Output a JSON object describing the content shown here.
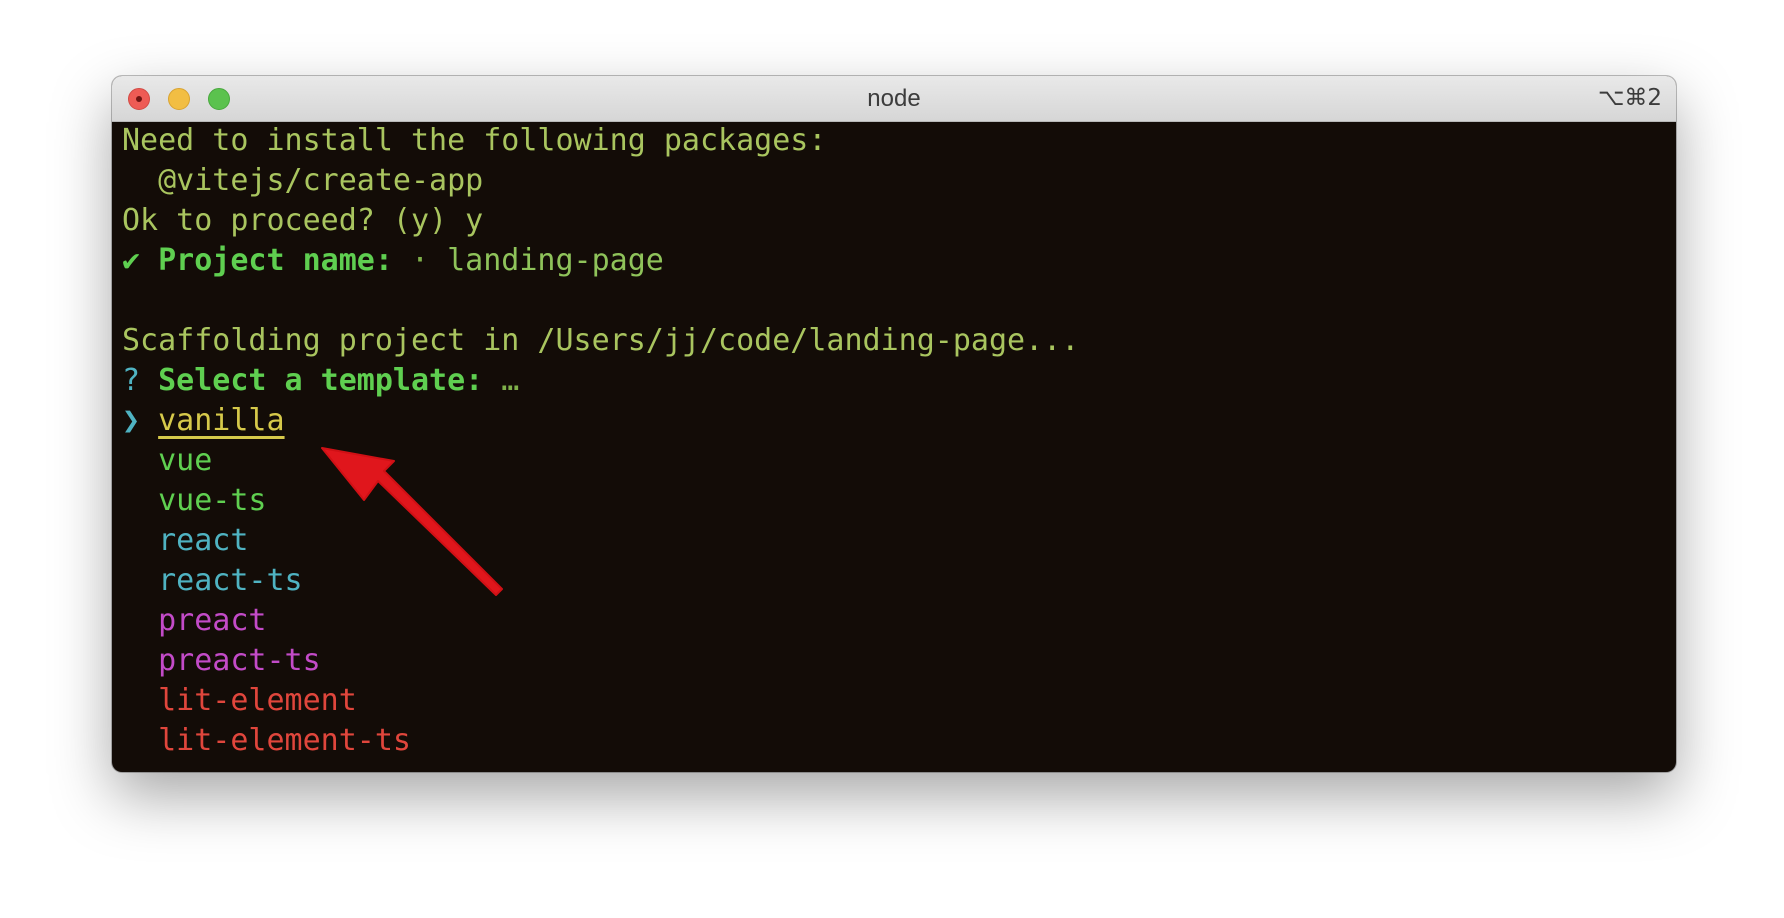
{
  "window": {
    "title": "node",
    "shortcut": "⌥⌘2"
  },
  "terminal": {
    "lines": {
      "install_msg": "Need to install the following packages:",
      "package": "  @vitejs/create-app",
      "proceed": "Ok to proceed? (y) y",
      "check_mark": "✔",
      "project_label": "Project name:",
      "project_sep": "·",
      "project_value": "landing-page",
      "scaffolding": "Scaffolding project in /Users/jj/code/landing-page...",
      "question_mark": "?",
      "select_label": "Select a template:",
      "ellipsis": "…",
      "cursor": "❯"
    },
    "templates": [
      {
        "label": "vanilla",
        "color": "#d6c94a",
        "selected": true
      },
      {
        "label": "vue",
        "color": "#5fcf50"
      },
      {
        "label": "vue-ts",
        "color": "#5fcf50"
      },
      {
        "label": "react",
        "color": "#4fb3c2"
      },
      {
        "label": "react-ts",
        "color": "#4fb3c2"
      },
      {
        "label": "preact",
        "color": "#c34bc8"
      },
      {
        "label": "preact-ts",
        "color": "#c34bc8"
      },
      {
        "label": "lit-element",
        "color": "#e0463c"
      },
      {
        "label": "lit-element-ts",
        "color": "#e0463c"
      }
    ]
  },
  "annotation": {
    "arrow_color": "#e0161c",
    "arrow_icon": "red-arrow-icon"
  }
}
